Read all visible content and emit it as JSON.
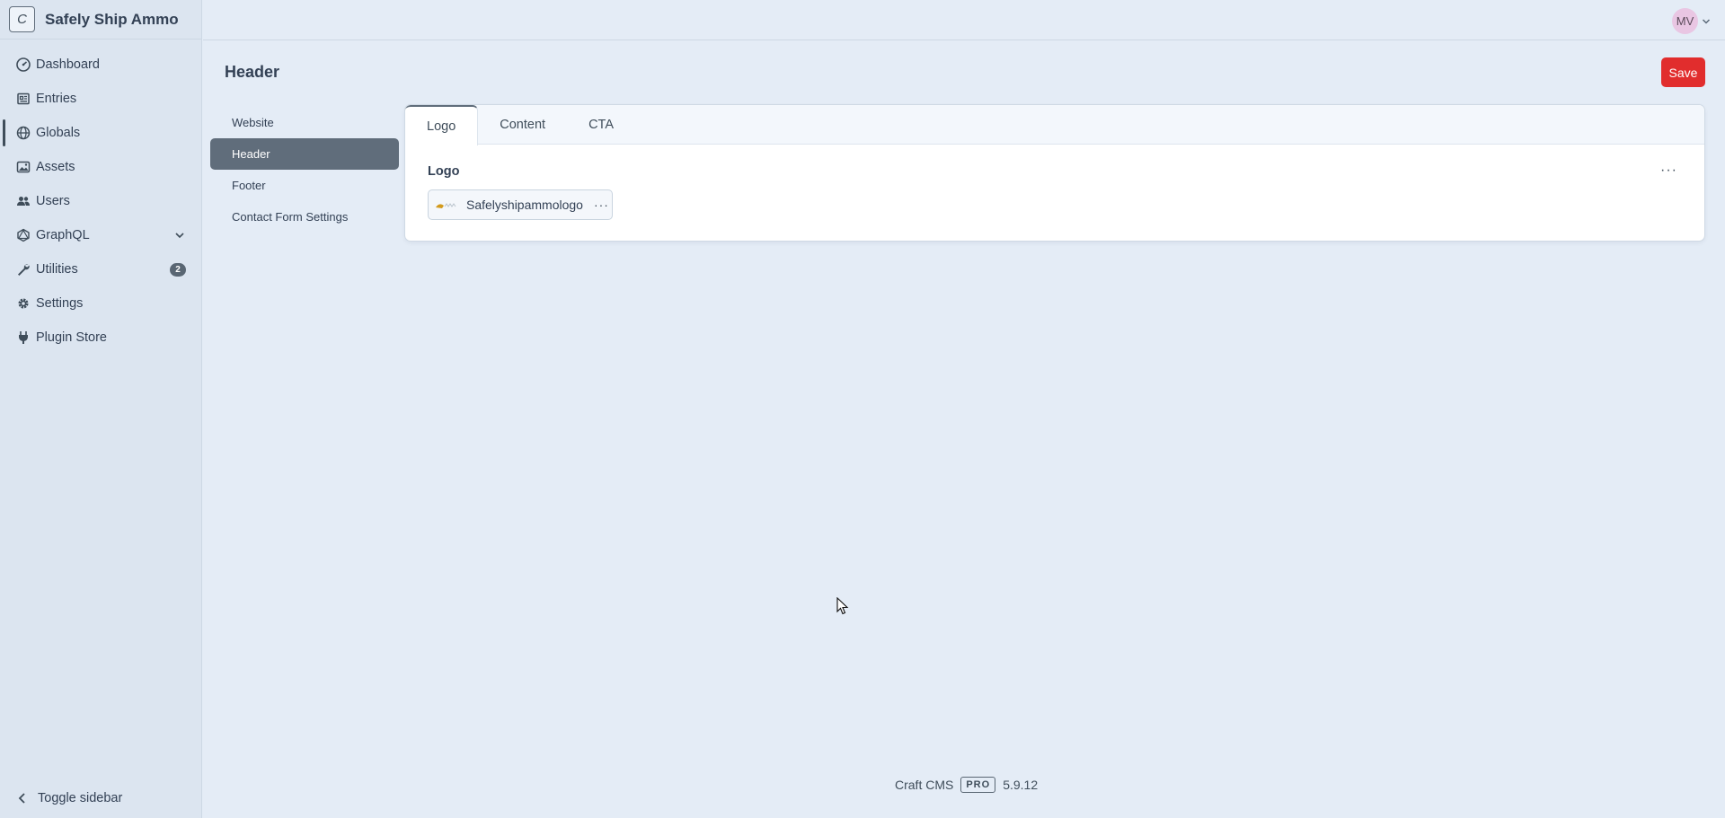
{
  "site": {
    "initial": "C",
    "name": "Safely Ship Ammo"
  },
  "sidebar": {
    "items": [
      {
        "label": "Dashboard",
        "icon": "gauge-icon"
      },
      {
        "label": "Entries",
        "icon": "newspaper-icon"
      },
      {
        "label": "Globals",
        "icon": "globe-icon"
      },
      {
        "label": "Assets",
        "icon": "image-icon"
      },
      {
        "label": "Users",
        "icon": "users-icon"
      },
      {
        "label": "GraphQL",
        "icon": "graphql-icon"
      },
      {
        "label": "Utilities",
        "icon": "wrench-icon",
        "badge": "2"
      },
      {
        "label": "Settings",
        "icon": "gear-icon"
      },
      {
        "label": "Plugin Store",
        "icon": "plug-icon"
      }
    ],
    "toggle_label": "Toggle sidebar"
  },
  "user": {
    "initials": "MV"
  },
  "page": {
    "title": "Header",
    "save_label": "Save"
  },
  "global_sets": [
    "Website",
    "Header",
    "Footer",
    "Contact Form Settings"
  ],
  "tabs": [
    "Logo",
    "Content",
    "CTA"
  ],
  "field": {
    "label": "Logo",
    "asset_name": "Safelyshipammologo",
    "actions": "···"
  },
  "footer": {
    "product": "Craft CMS",
    "edition": "PRO",
    "version": "5.9.12"
  },
  "colors": {
    "save": "#e12d2d",
    "selected": "#606d7b",
    "avatar": "#e9c6e3"
  }
}
